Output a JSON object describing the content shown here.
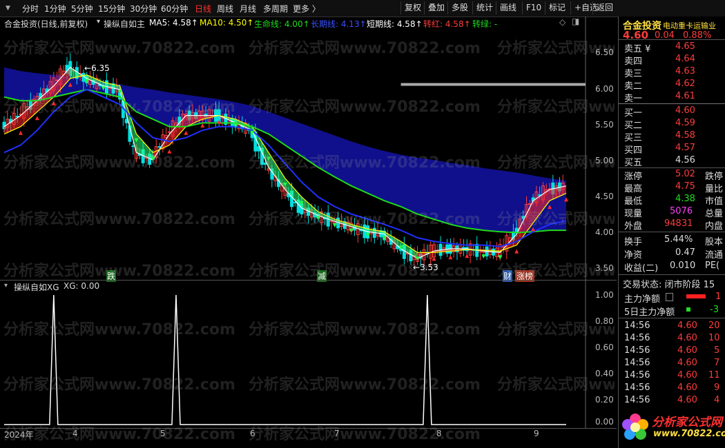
{
  "toolbar": {
    "timeframes": [
      "分时",
      "1分钟",
      "5分钟",
      "15分钟",
      "30分钟",
      "60分钟",
      "日线",
      "周线",
      "月线",
      "多周期",
      "更多 〉"
    ],
    "active_timeframe": "日线",
    "buttons": [
      "复权",
      "叠加",
      "多股",
      "统计",
      "画线",
      "F10",
      "标记",
      "+自选",
      "返回"
    ]
  },
  "main_header": {
    "stock_label": "合金投资(日线,前复权)",
    "indicator_name": "操纵自如主",
    "ma5": "MA5: 4.58↑",
    "ma10": "MA10: 4.50↑",
    "life_line": "生命线: 4.00↑",
    "long_line": "长期线: 4.13↑",
    "short_line": "短期线: 4.58↑",
    "turn_red": "转红: 4.58↑",
    "turn_green": "转绿: -"
  },
  "main_yaxis": [
    "6.50",
    "6.00",
    "5.50",
    "5.00",
    "4.50",
    "4.00",
    "3.50"
  ],
  "annotations": {
    "high": "6.35",
    "low": "3.53"
  },
  "signals": [
    "跌",
    "减",
    "财",
    "涨榜"
  ],
  "indicator_header": {
    "name": "操纵自如XG",
    "value": "XG: 0.00"
  },
  "ind_yaxis": [
    "1.00",
    "0.80",
    "0.60",
    "0.40",
    "0.20",
    "0.00"
  ],
  "xaxis": [
    "2024年",
    "4",
    "5",
    "6",
    "7",
    "8",
    "9"
  ],
  "watermark": "分析家公式网www.70822.com",
  "right_panel": {
    "name": "合金投资",
    "sub": "电动重卡运输业",
    "price": "4.60",
    "change": "0.04",
    "pct": "0.88%",
    "asks": [
      {
        "label": "卖五 ¥",
        "price": "4.65"
      },
      {
        "label": "卖四",
        "price": "4.64"
      },
      {
        "label": "卖三",
        "price": "4.63"
      },
      {
        "label": "卖二",
        "price": "4.62"
      },
      {
        "label": "卖一",
        "price": "4.61"
      }
    ],
    "bids": [
      {
        "label": "买一",
        "price": "4.60"
      },
      {
        "label": "买二",
        "price": "4.59"
      },
      {
        "label": "买三",
        "price": "4.58"
      },
      {
        "label": "买四",
        "price": "4.57"
      },
      {
        "label": "买五",
        "price": "4.56"
      }
    ],
    "stats": [
      {
        "label": "涨停",
        "value": "5.02",
        "label2": "跌停"
      },
      {
        "label": "最高",
        "value": "4.75",
        "label2": "量比"
      },
      {
        "label": "最低",
        "value": "4.38",
        "label2": "市值"
      },
      {
        "label": "现量",
        "value": "5076",
        "label2": "总量"
      },
      {
        "label": "外盘",
        "value": "94831",
        "label2": "内盘"
      }
    ],
    "stats2": [
      {
        "label": "换手",
        "value": "5.44%",
        "label2": "股本"
      },
      {
        "label": "净资",
        "value": "0.47",
        "label2": "流通"
      },
      {
        "label": "收益(二)",
        "value": "0.010",
        "label2": "PE("
      }
    ],
    "trade_status": "交易状态: 闭市阶段 15",
    "main_net": {
      "label": "主力净额",
      "value": "1"
    },
    "main_net5": {
      "label": "5日主力净额",
      "value": "-3"
    },
    "ticks": [
      {
        "time": "14:56",
        "price": "4.60",
        "vol": "20"
      },
      {
        "time": "14:56",
        "price": "4.60",
        "vol": "10"
      },
      {
        "time": "14:56",
        "price": "4.60",
        "vol": "5"
      },
      {
        "time": "14:56",
        "price": "4.60",
        "vol": "7"
      },
      {
        "time": "14:56",
        "price": "4.60",
        "vol": "11"
      },
      {
        "time": "14:56",
        "price": "4.60",
        "vol": "9"
      },
      {
        "time": "14:56",
        "price": "4.60",
        "vol": "4"
      }
    ],
    "logo_text": "分析家公式网",
    "logo_url": "www.70822.com"
  },
  "colors": {
    "up": "#ff3c3c",
    "down": "#00e0e0",
    "ma5": "#ffffff",
    "ma10": "#ffff00",
    "life": "#1ddc1d",
    "long": "#2030ff",
    "band": "#10108c"
  },
  "chart_data": {
    "type": "line",
    "x": [
      0,
      5,
      10,
      15,
      20,
      25,
      30,
      35,
      40,
      45,
      50,
      55,
      60,
      65,
      70,
      75,
      80,
      85,
      90,
      95,
      100,
      105,
      110,
      115,
      120,
      125,
      130,
      135,
      140,
      145,
      150,
      155,
      160,
      165,
      170
    ],
    "series": [
      {
        "values": [
          5.4,
          5.55,
          5.75,
          5.95,
          6.2,
          6.05,
          5.95,
          5.9,
          5.05,
          4.95,
          5.3,
          5.55,
          5.55,
          5.55,
          5.45,
          5.35,
          4.85,
          4.55,
          4.3,
          4.2,
          4.12,
          4.05,
          3.98,
          3.95,
          3.75,
          3.62,
          3.72,
          3.75,
          3.75,
          3.72,
          3.7,
          3.95,
          4.4,
          4.55,
          4.6
        ]
      },
      {
        "values": [
          5.3,
          5.4,
          5.6,
          5.8,
          6.05,
          6.1,
          6.0,
          5.95,
          5.3,
          5.05,
          5.15,
          5.4,
          5.5,
          5.55,
          5.5,
          5.4,
          5.05,
          4.7,
          4.45,
          4.25,
          4.15,
          4.08,
          4.02,
          3.98,
          3.85,
          3.7,
          3.7,
          3.72,
          3.74,
          3.73,
          3.72,
          3.8,
          4.1,
          4.4,
          4.5
        ]
      },
      {
        "values": [
          5.8,
          5.75,
          5.75,
          5.8,
          5.85,
          5.9,
          5.85,
          5.8,
          5.6,
          5.5,
          5.4,
          5.4,
          5.45,
          5.45,
          5.45,
          5.4,
          5.3,
          5.15,
          5.0,
          4.85,
          4.72,
          4.6,
          4.5,
          4.4,
          4.32,
          4.22,
          4.15,
          4.08,
          4.03,
          4.0,
          3.98,
          3.97,
          3.98,
          4.0,
          4.0
        ]
      },
      {
        "values": [
          5.05,
          5.15,
          5.35,
          5.6,
          5.8,
          5.9,
          5.8,
          5.7,
          5.45,
          5.25,
          5.2,
          5.25,
          5.35,
          5.4,
          5.4,
          5.35,
          5.15,
          4.9,
          4.65,
          4.45,
          4.32,
          4.22,
          4.15,
          4.08,
          4.0,
          3.9,
          3.85,
          3.82,
          3.8,
          3.8,
          3.78,
          3.85,
          3.98,
          4.08,
          4.13
        ]
      },
      {
        "values": [
          6.2,
          6.15,
          6.12,
          6.1,
          6.08,
          6.05,
          6.0,
          5.97,
          5.93,
          5.9,
          5.86,
          5.83,
          5.8,
          5.77,
          5.73,
          5.68,
          5.6,
          5.52,
          5.44,
          5.36,
          5.28,
          5.2,
          5.13,
          5.07,
          5.02,
          4.98,
          4.95,
          4.91,
          4.88,
          4.84,
          4.81,
          4.78,
          4.74,
          4.7,
          4.67
        ]
      },
      {
        "values": [
          0,
          0,
          0,
          0,
          0,
          0,
          0,
          0,
          0,
          0,
          0,
          0,
          0,
          0,
          0,
          0,
          0,
          0,
          0,
          0,
          0,
          0,
          0,
          0,
          0,
          0,
          0,
          0,
          0,
          0,
          0,
          0,
          0,
          0,
          0
        ]
      }
    ],
    "ylim": [
      3.35,
      6.7
    ],
    "grid": false,
    "indicator": {
      "x": [
        0,
        15,
        52,
        100,
        133,
        170
      ],
      "xg_spike_positions": [
        15,
        52,
        128
      ],
      "ylim": [
        0,
        1
      ]
    }
  }
}
